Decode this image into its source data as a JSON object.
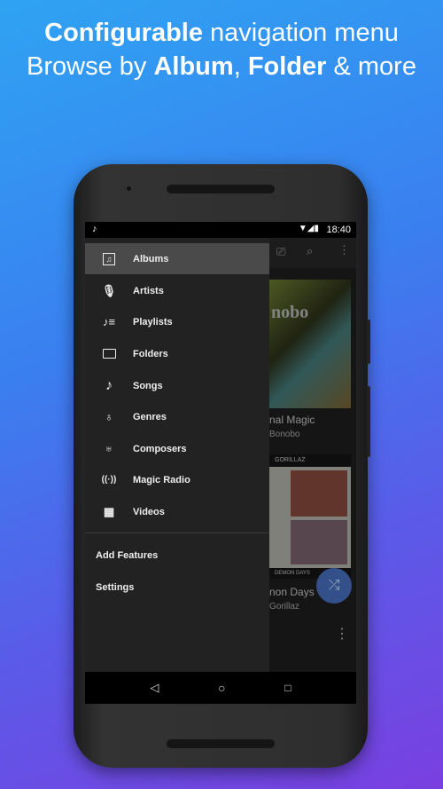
{
  "headline": {
    "line1_bold": "Configurable",
    "line1_rest": " navigation menu",
    "line2_pre": "Browse by ",
    "line2_b1": "Album",
    ", ": ", ",
    "line2_sep": ", ",
    "line2_b2": "Folder",
    "line2_post": " & more"
  },
  "status": {
    "time": "18:40",
    "app_icon": "music-note-icon"
  },
  "drawer": {
    "items": [
      {
        "label": "Albums",
        "icon": "album-icon",
        "selected": true
      },
      {
        "label": "Artists",
        "icon": "microphone-icon"
      },
      {
        "label": "Playlists",
        "icon": "playlist-icon"
      },
      {
        "label": "Folders",
        "icon": "folder-icon"
      },
      {
        "label": "Songs",
        "icon": "music-note-icon"
      },
      {
        "label": "Genres",
        "icon": "trumpet-icon"
      },
      {
        "label": "Composers",
        "icon": "lyre-icon"
      },
      {
        "label": "Magic Radio",
        "icon": "radio-icon"
      },
      {
        "label": "Videos",
        "icon": "film-icon"
      }
    ],
    "extra": [
      "Add Features",
      "Settings"
    ]
  },
  "albums": [
    {
      "title": "Animal Magic",
      "title_visible": "nal Magic",
      "artist_visible": "Bonobo",
      "cover_text": "nobo"
    },
    {
      "title": "Demon Days",
      "title_visible": "non Days",
      "artist_visible": "Gorillaz",
      "cover_top": "GORILLAZ",
      "cover_bottom": "DEMON DAYS"
    }
  ],
  "colors": {
    "fab": "#4a78d8",
    "drawer_bg": "#222222",
    "selected": "#4a4a4a"
  }
}
